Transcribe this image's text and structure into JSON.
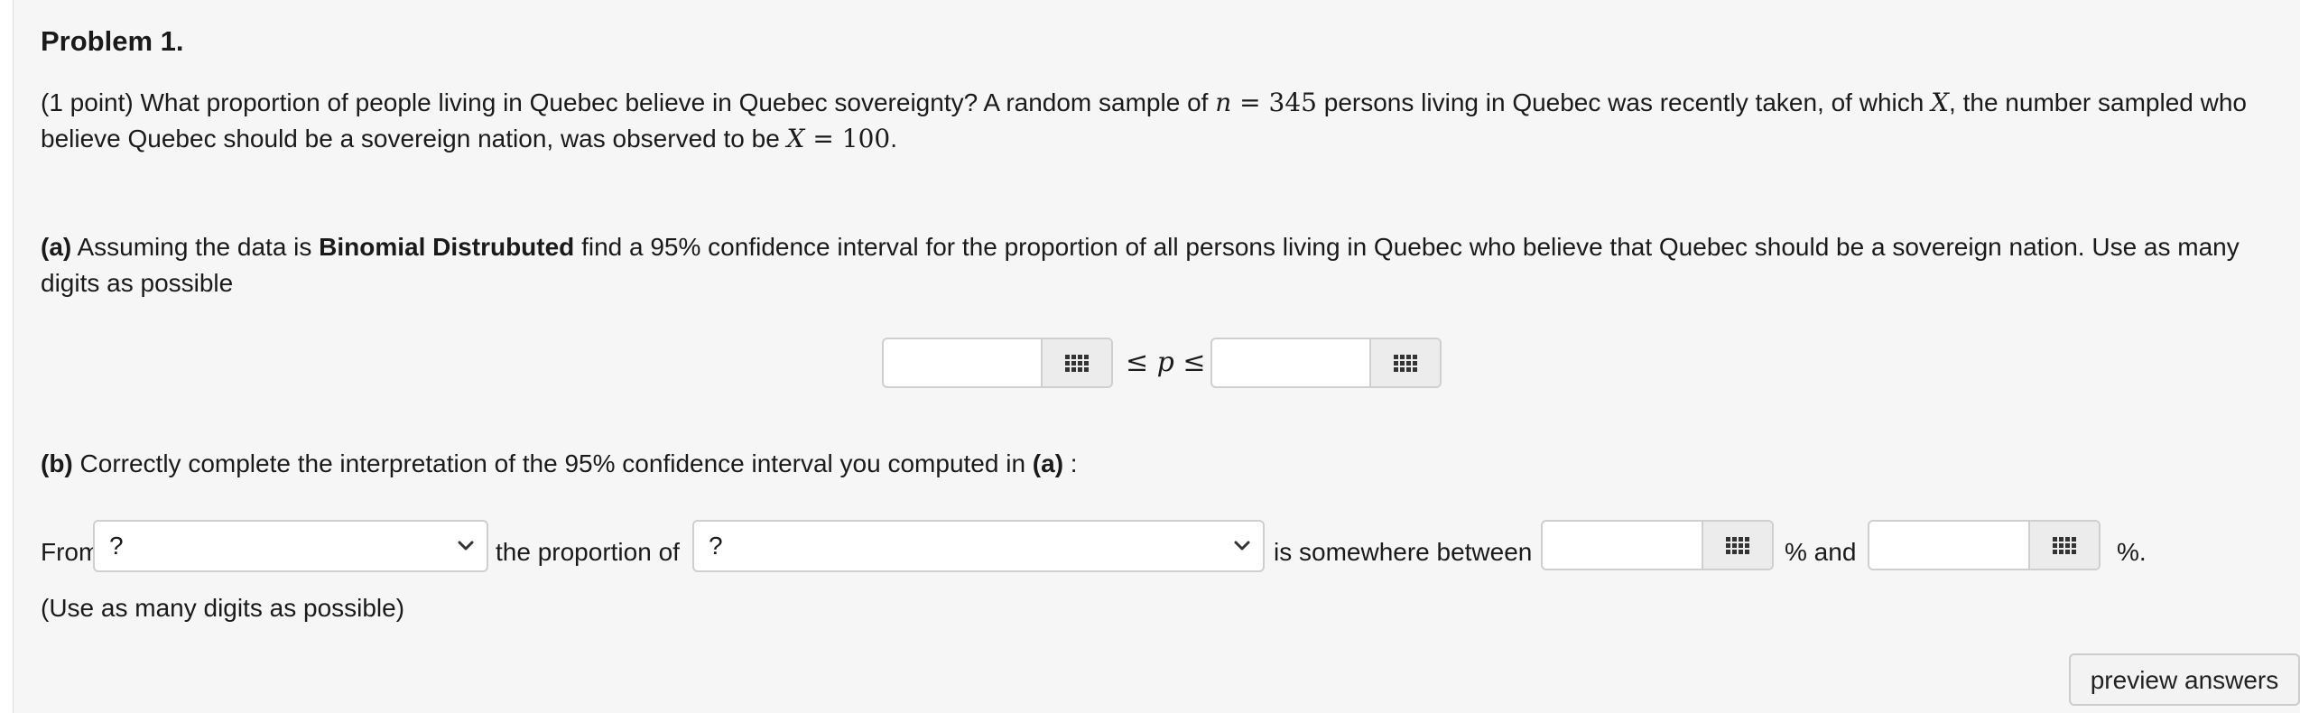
{
  "problem": {
    "title": "Problem 1.",
    "intro_p1": "(1 point) What proportion of people living in Quebec believe in Quebec sovereignty? A random sample of ",
    "n_var": "n",
    "eq1": " = ",
    "n_value": "345",
    "intro_p2": " persons living in Quebec was recently taken, of which ",
    "x_var": "X",
    "intro_p3": ", the number sampled who",
    "line2_p1": "believe Quebec should be a sovereign nation, was observed to be ",
    "x_var2": "X",
    "eq2": " = ",
    "x_value": "100",
    "period": "."
  },
  "part_a": {
    "label": "(a)",
    "text1": " Assuming the data is ",
    "bold": "Binomial Distrubuted",
    "text2": " find a 95% confidence interval for the proportion of all persons living in Quebec who believe that Quebec should be a sovereign nation. Use as many",
    "line2": "digits as possible",
    "ineq": "≤ p ≤",
    "lower_value": "",
    "upper_value": ""
  },
  "part_b": {
    "label": "(b)",
    "text1": " Correctly complete the interpretation of the 95% confidence interval you computed in ",
    "ref": "(a)",
    "colon": " :",
    "from": "From",
    "select1_value": "?",
    "the_proportion_of": "the proportion of",
    "select2_value": "?",
    "between": "is somewhere between",
    "and": "% and",
    "pct": "%.",
    "low_pct_value": "",
    "high_pct_value": "",
    "note": "(Use as many digits as possible)"
  },
  "buttons": {
    "preview": "preview answers"
  },
  "icons": {
    "palette": "grid-palette-icon",
    "dropdown": "chevron-down-icon"
  }
}
